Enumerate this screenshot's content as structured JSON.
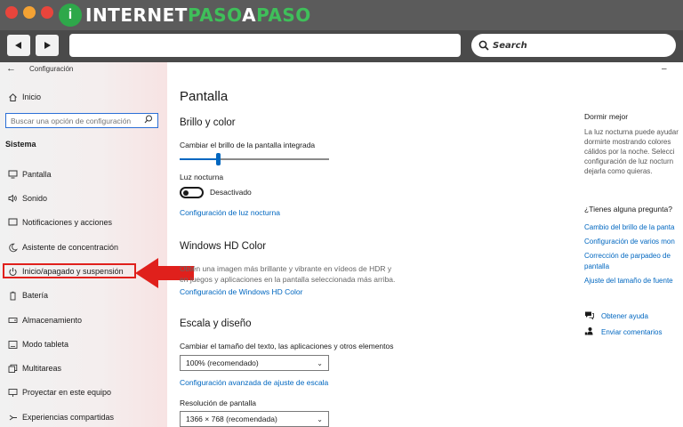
{
  "browser": {
    "logo_letter": "i",
    "logo_text_a": "INTERNET",
    "logo_text_b": "PASO",
    "logo_text_c": "A",
    "logo_text_d": "PASO",
    "search_label": "Search",
    "dot_colors": [
      "#e8453c",
      "#f4a233",
      "#e8453c"
    ]
  },
  "window": {
    "app_title": "Configuración",
    "home_label": "Inicio",
    "search_placeholder": "Buscar una opción de configuración",
    "section_title": "Sistema",
    "nav_items": [
      {
        "label": "Pantalla",
        "icon": "monitor-icon"
      },
      {
        "label": "Sonido",
        "icon": "speaker-icon"
      },
      {
        "label": "Notificaciones y acciones",
        "icon": "notification-icon"
      },
      {
        "label": "Asistente de concentración",
        "icon": "moon-icon"
      },
      {
        "label": "Inicio/apagado y suspensión",
        "icon": "power-icon"
      },
      {
        "label": "Batería",
        "icon": "battery-icon"
      },
      {
        "label": "Almacenamiento",
        "icon": "storage-icon"
      },
      {
        "label": "Modo tableta",
        "icon": "tablet-icon"
      },
      {
        "label": "Multitareas",
        "icon": "multitask-icon"
      },
      {
        "label": "Proyectar en este equipo",
        "icon": "project-icon"
      },
      {
        "label": "Experiencias compartidas",
        "icon": "share-icon"
      }
    ]
  },
  "main": {
    "title": "Pantalla",
    "brightness": {
      "heading": "Brillo y color",
      "slider_label": "Cambiar el brillo de la pantalla integrada",
      "slider_value": 0.26,
      "night_light_label": "Luz nocturna",
      "night_light_state": "Desactivado",
      "night_light_link": "Configuración de luz nocturna"
    },
    "hdr": {
      "heading": "Windows HD Color",
      "desc_line1": "Obtén una imagen más brillante y vibrante en vídeos de HDR y",
      "desc_line2": "en juegos y aplicaciones en la pantalla seleccionada más arriba.",
      "link": "Configuración de Windows HD Color"
    },
    "layout": {
      "heading": "Escala y diseño",
      "scale_label": "Cambiar el tamaño del texto, las aplicaciones y otros elementos",
      "scale_value": "100% (recomendado)",
      "advanced_link": "Configuración avanzada de ajuste de escala",
      "resolution_label": "Resolución de pantalla",
      "resolution_value": "1366 × 768 (recomendada)"
    }
  },
  "right": {
    "sleep_heading": "Dormir mejor",
    "sleep_lines": [
      "La luz nocturna puede ayudar",
      "dormirte mostrando colores",
      "cálidos por la noche. Selecci",
      "configuración de luz nocturn",
      "dejarla como quieras."
    ],
    "question_heading": "¿Tienes alguna pregunta?",
    "question_links": [
      "Cambio del brillo de la panta",
      "Configuración de varios mon",
      "Corrección de parpadeo de",
      "pantalla",
      "Ajuste del tamaño de fuente"
    ],
    "help_label": "Obtener ayuda",
    "feedback_label": "Enviar comentarios"
  },
  "colors": {
    "accent": "#0067c0",
    "highlight": "#e0201c",
    "brand_green": "#2ea84a"
  }
}
